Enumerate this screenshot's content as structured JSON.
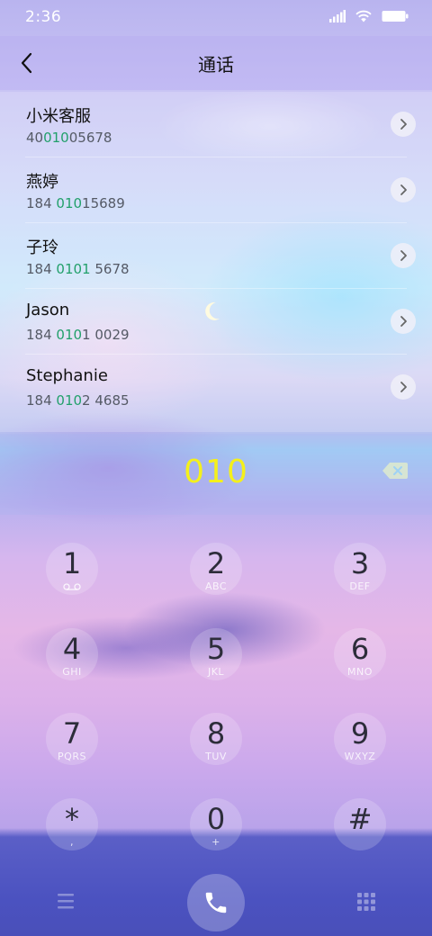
{
  "status_bar": {
    "time": "2:36",
    "icons": [
      "signal-icon",
      "wifi-icon",
      "battery-icon"
    ]
  },
  "header": {
    "title": "通话",
    "back_icon": "chevron-left-icon"
  },
  "results": [
    {
      "name": "小米客服",
      "number_pre": "40",
      "number_match": "010",
      "number_post": "05678"
    },
    {
      "name": "燕婷",
      "number_pre": "184 ",
      "number_match": "010",
      "number_post": "15689"
    },
    {
      "name": "子玲",
      "number_pre": "184 ",
      "number_match": "0101",
      "number_post": " 5678"
    },
    {
      "name": "Jason",
      "number_pre": "184 ",
      "number_match": "010",
      "number_post": "1 0029"
    },
    {
      "name": "Stephanie",
      "number_pre": "184 ",
      "number_match": "010",
      "number_post": "2 4685"
    }
  ],
  "dialer": {
    "number": "010",
    "delete_icon": "backspace-icon"
  },
  "keypad": {
    "keys": [
      {
        "digit": "1",
        "letters": ""
      },
      {
        "digit": "2",
        "letters": "ABC"
      },
      {
        "digit": "3",
        "letters": "DEF"
      },
      {
        "digit": "4",
        "letters": "GHI"
      },
      {
        "digit": "5",
        "letters": "JKL"
      },
      {
        "digit": "6",
        "letters": "MNO"
      },
      {
        "digit": "7",
        "letters": "PQRS"
      },
      {
        "digit": "8",
        "letters": "TUV"
      },
      {
        "digit": "9",
        "letters": "WXYZ"
      },
      {
        "digit": "*",
        "letters": ","
      },
      {
        "digit": "0",
        "letters": "+"
      },
      {
        "digit": "#",
        "letters": ""
      }
    ]
  },
  "bottom_bar": {
    "menu_icon": "menu-icon",
    "call_icon": "phone-icon",
    "keypad_icon": "dialpad-icon"
  },
  "colors": {
    "match_highlight": "#22a06b",
    "dialed_number": "#f4f01c"
  }
}
